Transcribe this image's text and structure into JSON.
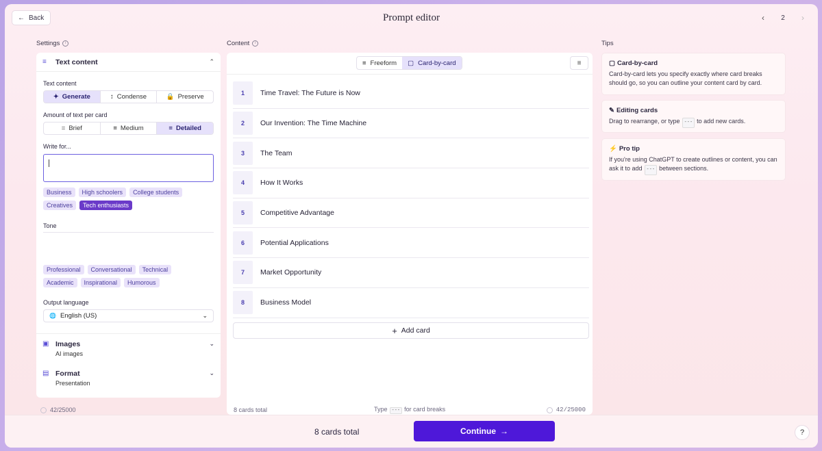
{
  "header": {
    "back_label": "Back",
    "title": "Prompt editor",
    "page_number": "2"
  },
  "columns": {
    "settings": "Settings",
    "content": "Content",
    "tips": "Tips"
  },
  "settings": {
    "text_content": {
      "title": "Text content",
      "mode_label": "Text content",
      "modes": [
        "Generate",
        "Condense",
        "Preserve"
      ],
      "selected_mode": "Generate",
      "amount_label": "Amount of text per card",
      "amounts": [
        "Brief",
        "Medium",
        "Detailed"
      ],
      "selected_amount": "Detailed",
      "write_for_label": "Write for...",
      "write_for_value": "",
      "audience_tags": [
        "Business",
        "High schoolers",
        "College students",
        "Creatives",
        "Tech enthusiasts"
      ],
      "hovered_audience": "Tech enthusiasts",
      "tone_label": "Tone",
      "tone_value": "",
      "tone_tags": [
        "Professional",
        "Conversational",
        "Technical",
        "Academic",
        "Inspirational",
        "Humorous"
      ],
      "output_language_label": "Output language",
      "output_language": "English (US)"
    },
    "images": {
      "title": "Images",
      "subtitle": "AI images"
    },
    "format": {
      "title": "Format",
      "subtitle": "Presentation"
    },
    "char_count": "42/25000"
  },
  "content": {
    "view_modes": [
      "Freeform",
      "Card-by-card"
    ],
    "selected_view": "Card-by-card",
    "cards": [
      {
        "num": "1",
        "title": "Time Travel: The Future is Now"
      },
      {
        "num": "2",
        "title": "Our Invention: The Time Machine"
      },
      {
        "num": "3",
        "title": "The Team"
      },
      {
        "num": "4",
        "title": "How It Works"
      },
      {
        "num": "5",
        "title": "Competitive Advantage"
      },
      {
        "num": "6",
        "title": "Potential Applications"
      },
      {
        "num": "7",
        "title": "Market Opportunity"
      },
      {
        "num": "8",
        "title": "Business Model"
      }
    ],
    "add_card_label": "Add card",
    "footer_total": "8 cards total",
    "footer_hint_pre": "Type",
    "footer_hint_kbd": "---",
    "footer_hint_post": "for card breaks",
    "char_count": "42/25000"
  },
  "tips": [
    {
      "title": "Card-by-card",
      "body": "Card-by-card lets you specify exactly where card breaks should go, so you can outline your content card by card."
    },
    {
      "title": "Editing cards",
      "body_pre": "Drag to rearrange, or type",
      "kbd": "---",
      "body_post": "to add new cards."
    },
    {
      "title": "Pro tip",
      "body_pre": "If you're using ChatGPT to create outlines or content, you can ask it to add",
      "kbd": "---",
      "body_post": "between sections."
    }
  ],
  "footer": {
    "total": "8 cards total",
    "continue_label": "Continue",
    "help_label": "?"
  },
  "colors": {
    "accent": "#4e18d9",
    "tag_selected": "#6a3ac9",
    "tag_bg": "#e9e2fa"
  }
}
